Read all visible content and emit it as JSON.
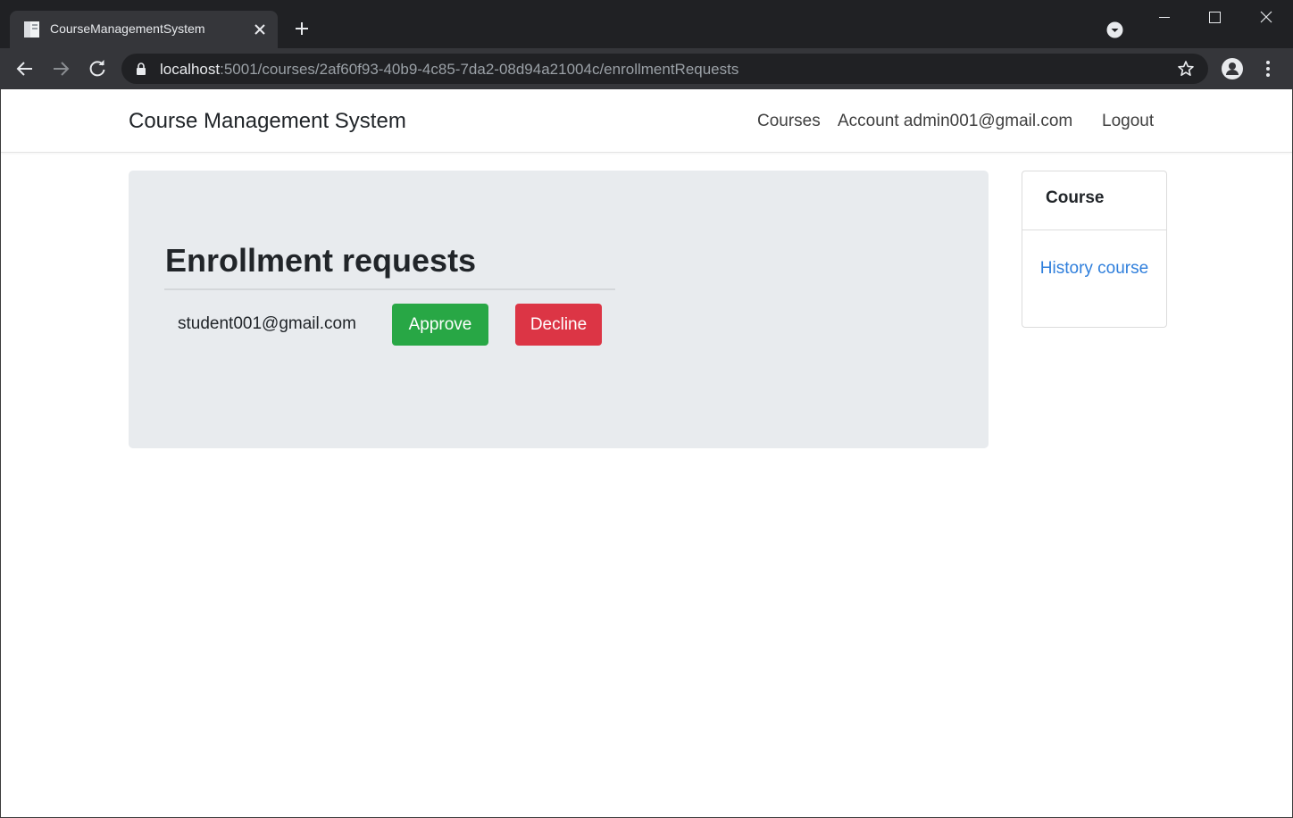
{
  "browser": {
    "tab_title": "CourseManagementSystem",
    "url_host": "localhost",
    "url_rest": ":5001/courses/2af60f93-40b9-4c85-7da2-08d94a21004c/enrollmentRequests"
  },
  "navbar": {
    "brand": "Course Management System",
    "links": {
      "courses": "Courses",
      "account": "Account admin001@gmail.com",
      "logout": "Logout"
    }
  },
  "main": {
    "title": "Enrollment requests",
    "requests": [
      {
        "email": "student001@gmail.com",
        "approve_label": "Approve",
        "decline_label": "Decline"
      }
    ]
  },
  "sidebar": {
    "title": "Course",
    "link": "History course"
  },
  "colors": {
    "approve": "#28a745",
    "decline": "#dc3545",
    "link": "#2f7fdc",
    "jumbotron_bg": "#e8ebee"
  },
  "icons": [
    "page-favicon-icon",
    "close-icon",
    "plus-icon",
    "tab-search-icon",
    "minimize-icon",
    "maximize-icon",
    "window-close-icon",
    "back-arrow-icon",
    "forward-arrow-icon",
    "reload-icon",
    "lock-icon",
    "star-icon",
    "profile-icon",
    "menu-dots-icon"
  ]
}
